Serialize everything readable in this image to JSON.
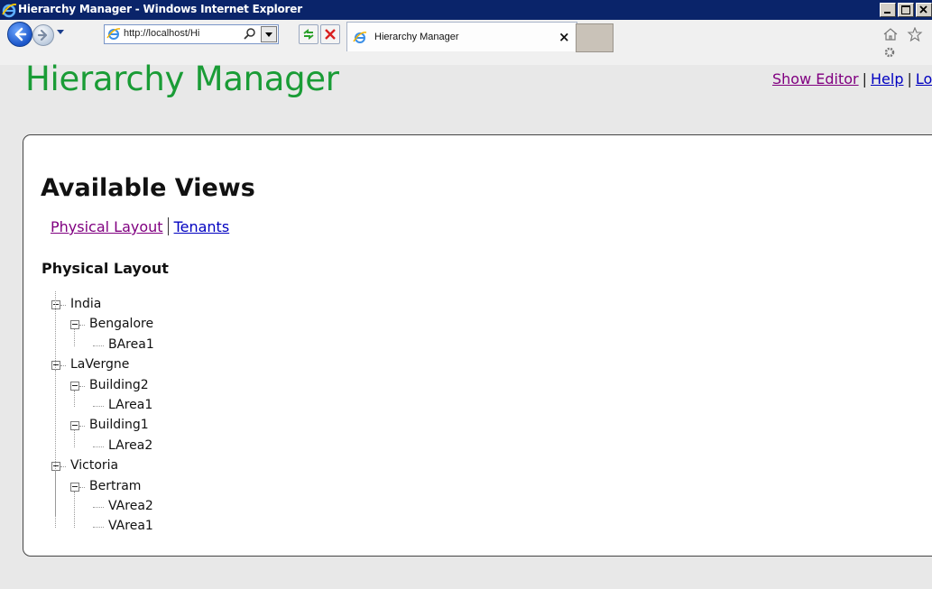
{
  "window": {
    "title": "Hierarchy Manager - Windows Internet Explorer"
  },
  "browser": {
    "address": "http://localhost/Hi",
    "tab_title": "Hierarchy Manager",
    "tab_close": "×"
  },
  "header": {
    "site_title": "Hierarchy Manager",
    "links": {
      "show_editor": "Show Editor",
      "help": "Help",
      "logout": "Logout",
      "separator": "|"
    }
  },
  "main": {
    "heading": "Available Views",
    "views": [
      {
        "label": "Physical Layout",
        "visited": true
      },
      {
        "label": "Tenants",
        "visited": false
      }
    ],
    "current_view_title": "Physical Layout",
    "tree": [
      {
        "label": "India",
        "children": [
          {
            "label": "Bengalore",
            "children": [
              {
                "label": "BArea1"
              }
            ]
          }
        ]
      },
      {
        "label": "LaVergne",
        "children": [
          {
            "label": "Building2",
            "children": [
              {
                "label": "LArea1"
              }
            ]
          },
          {
            "label": "Building1",
            "children": [
              {
                "label": "LArea2"
              }
            ]
          }
        ]
      },
      {
        "label": "Victoria",
        "children": [
          {
            "label": "Bertram",
            "children": [
              {
                "label": "VArea2"
              },
              {
                "label": "VArea1"
              }
            ]
          }
        ]
      }
    ]
  },
  "icons": {
    "ie_logo": "ie-logo-icon",
    "back": "back-arrow-icon",
    "forward": "forward-arrow-icon",
    "search": "search-icon",
    "refresh": "refresh-icon",
    "stop": "stop-icon",
    "home": "home-icon",
    "favorites": "star-icon",
    "tools": "gear-icon"
  },
  "colors": {
    "title_bar": "#0a246a",
    "site_title": "#1a9c36",
    "link": "#0000c0",
    "visited_link": "#800080"
  }
}
